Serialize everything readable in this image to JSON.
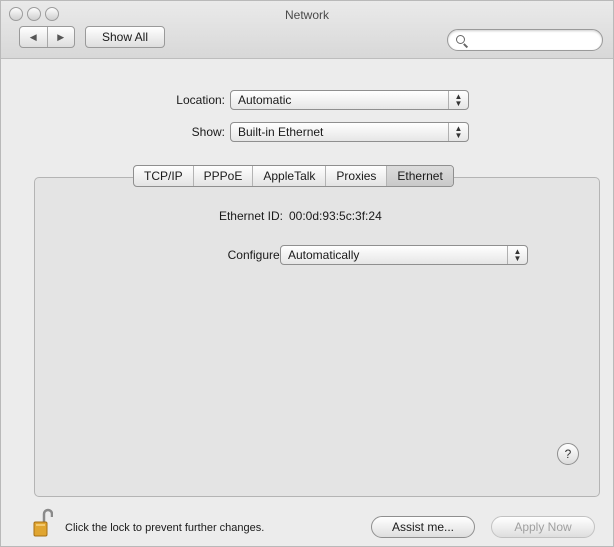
{
  "window": {
    "title": "Network"
  },
  "toolbar": {
    "back_label": "◀",
    "forward_label": "▶",
    "show_all_label": "Show All",
    "search_placeholder": "",
    "search_value": ""
  },
  "location": {
    "label": "Location:",
    "value": "Automatic"
  },
  "show": {
    "label": "Show:",
    "value": "Built-in Ethernet"
  },
  "tabs": [
    {
      "label": "TCP/IP",
      "active": false
    },
    {
      "label": "PPPoE",
      "active": false
    },
    {
      "label": "AppleTalk",
      "active": false
    },
    {
      "label": "Proxies",
      "active": false
    },
    {
      "label": "Ethernet",
      "active": true
    }
  ],
  "ethernet": {
    "id_label": "Ethernet ID:",
    "id_value": "00:0d:93:5c:3f:24",
    "configure_label": "Configure:",
    "configure_value": "Automatically"
  },
  "help": {
    "label": "?"
  },
  "footer": {
    "lock_text": "Click the lock to prevent further changes.",
    "assist_label": "Assist me...",
    "apply_label": "Apply Now"
  }
}
